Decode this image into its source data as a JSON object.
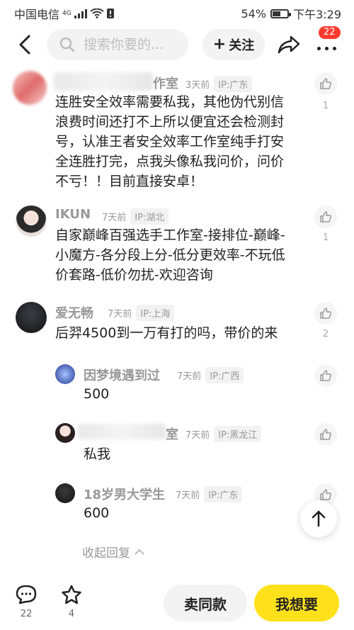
{
  "status_bar": {
    "carrier": "中国电信",
    "network": "4G",
    "battery": "54%",
    "battery_level": 0.54,
    "time": "下午3:29"
  },
  "header": {
    "search_placeholder": "搜索你要的...",
    "follow_label": "关注",
    "notification_count": "22"
  },
  "comments": [
    {
      "name": "作室",
      "time": "3天前",
      "ip": "IP:广东",
      "text": "连胜安全效率需要私我，其他伪代别信浪费时间还打不上所以便宜还会检测封号，认准王者安全效率工作室纯手打安全连胜打完，点我头像私我问价，问价不亏！！目前直接安卓！",
      "likes": "1"
    },
    {
      "name": "IKUN",
      "time": "7天前",
      "ip": "IP:湖北",
      "text": "自家巅峰百强选手工作室-接排位-巅峰-小魔方-各分段上分-低分更效率-不玩低价套路-低价勿扰-欢迎咨询",
      "likes": "1"
    },
    {
      "name": "爱无畅",
      "time": "7天前",
      "ip": "IP:上海",
      "text": "后羿4500到一万有打的吗，带价的来",
      "likes": "2"
    }
  ],
  "replies": [
    {
      "name": "因梦境遇到过",
      "time": "7天前",
      "ip": "IP:广西",
      "text": "500"
    },
    {
      "name": "室",
      "time": "7天前",
      "ip": "IP:黑龙江",
      "text": "私我"
    },
    {
      "name": "18岁男大学生",
      "time": "7天前",
      "ip": "IP:广东",
      "text": "600"
    }
  ],
  "collapse_label": "收起回复",
  "bottom_bar": {
    "comment_count": "22",
    "star_count": "4",
    "same_label": "卖同款",
    "want_label": "我想要"
  },
  "colors": {
    "accent_yellow": "#ffe11b",
    "badge_red": "#ff3b30"
  }
}
